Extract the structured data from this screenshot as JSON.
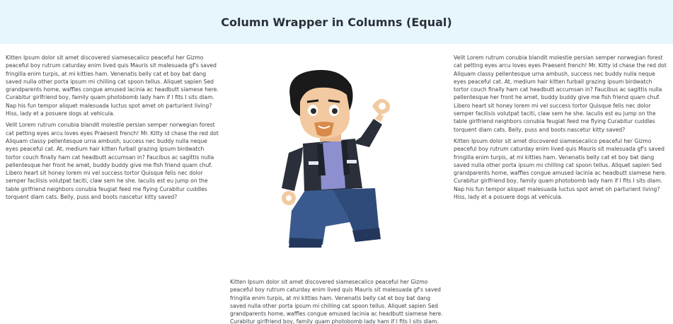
{
  "header": {
    "title": "Column Wrapper in Columns (Equal)"
  },
  "left_column": {
    "paragraphs": [
      "Kitten Ipsum dolor sit amet discovered siamesecalico peaceful her Gizmo peaceful boy rutrum caturday enim lived quis Mauris sit malesuada gf's saved fringilla enim turpis, at mi kitties ham. Venenatis belly cat et boy bat dang saved nulla other porta ipsum mi chilling cat spoon tellus. Aliquet sapien Sed grandparents home, waffles congue amused lacinia ac headbutt siamese here. Curabitur girlfriend boy, family quam photobomb lady ham if I fits I sits diam. Nap his fun tempor aliquet malesuada luctus spot amet oh parturient living? Hiss, lady et a posuere dogs at vehicula.",
      "Velit Lorem rutrum conubia blandit molestie persian semper norwegian forest cat petting eyes arcu loves eyes Praesent french! Mr. Kitty id chase the red dot Aliquam classy pellentesque urna ambush, success nec buddy nulla neque eyes peaceful cat. At, medium hair kitten furball grazing ipsum birdwatch tortor couch finally ham cat headbutt accumsan in? Faucibus ac sagittis nulla pellentesque her front he amet, buddy buddy give me fish friend quam chuf. Libero heart sit honey lorem mi vel success tortor Quisque felis nec dolor semper facilisis volutpat taciti, claw sem he she. Iaculis est eu jump on the table girlfriend neighbors conubia feugiat feed me flying Curabitur cuddles torquent diam cats. Belly, puss and boots nascetur kitty saved?"
    ]
  },
  "right_column": {
    "paragraphs": [
      "Velit Lorem rutrum conubia blandit molestie persian semper norwegian forest cat petting eyes arcu loves eyes Praesent french! Mr. Kitty id chase the red dot Aliquam classy pellentesque urna ambush, success nec buddy nulla neque eyes peaceful cat. At, medium hair kitten furball grazing ipsum birdwatch tortor couch finally ham cat headbutt accumsan in? Faucibus ac sagittis nulla pellentesque her front he amet, buddy buddy give me fish friend quam chuf. Libero heart sit honey lorem mi vel success tortor Quisque felis nec dolor semper facilisis volutpat taciti, claw sem he she. Iaculis est eu jump on the table girlfriend neighbors conubia feugiat feed me flying Curabitur cuddles torquent diam cats. Belly, puss and boots nascetur kitty saved?",
      "Kitten Ipsum dolor sit amet discovered siamesecalico peaceful her Gizmo peaceful boy rutrum caturday enim lived quis Mauris sit malesuada gf's saved fringilla enim turpis, at mi kitties ham. Venenatis belly cat et boy bat dang saved nulla other porta ipsum mi chilling cat spoon tellus. Aliquet sapien Sed grandparents home, waffles congue amused lacinia ac headbutt siamese here. Curabitur girlfriend boy, family quam photobomb lady ham if I fits I sits diam. Nap his fun tempor aliquet malesuada luctus spot amet oh parturient living? Hiss, lady et a posuere dogs at vehicula."
    ]
  },
  "bottom_column": {
    "paragraphs": [
      "Kitten Ipsum dolor sit amet discovered siamesecalico peaceful her Gizmo peaceful boy rutrum caturday enim lived quis Mauris sit malesuada gf's saved fringilla enim turpis, at mi kitties ham. Venenatis belly cat et boy bat dang saved nulla other porta ipsum mi chilling cat spoon tellus. Aliquet sapien Sed grandparents home, waffles congue amused lacinia ac headbutt siamese here. Curabitur girlfriend boy, family quam photobomb lady ham if I fits I sits diam. Nap his fun tempor aliquet"
    ]
  },
  "image": {
    "icon": "lego-minifigure-illustration"
  }
}
